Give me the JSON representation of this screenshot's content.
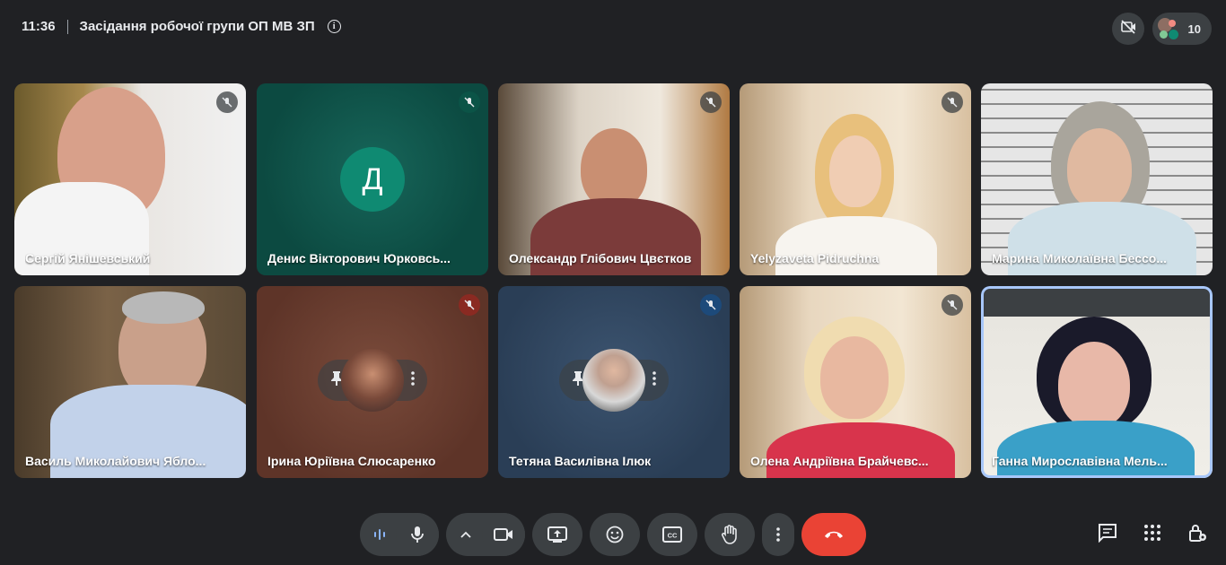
{
  "meeting": {
    "time": "11:36",
    "title": "Засідання робочої групи ОП МВ ЗП",
    "participant_count": "10"
  },
  "participants": [
    {
      "name": "Сергій Янішевський",
      "muted": true
    },
    {
      "name": "Денис Вікторович Юрковсь...",
      "avatar_letter": "Д",
      "muted": true
    },
    {
      "name": "Олександр Глібович Цвєтков",
      "muted": true
    },
    {
      "name": "Yelyzaveta Pidruchna",
      "muted": true
    },
    {
      "name": "Марина Миколаївна Бессо...",
      "muted": false
    },
    {
      "name": "Василь Миколайович Ябло...",
      "muted": false
    },
    {
      "name": "Ірина Юріївна Слюсаренко",
      "muted": true
    },
    {
      "name": "Тетяна Василівна Ілюк",
      "muted": true
    },
    {
      "name": "Олена Андріївна Брайчевс...",
      "muted": true
    },
    {
      "name": "Ганна Мирославівна Мель...",
      "muted": false,
      "speaking": true
    }
  ],
  "colors": {
    "background": "#202124",
    "control": "#3c4043",
    "end_call": "#ea4335",
    "active_border": "#a8c7fa",
    "avatar_teal": "#0f8a72"
  },
  "icons": {
    "info": "info-icon",
    "camera_off_top": "camera-off-icon",
    "audio_levels": "audio-level-icon",
    "microphone": "microphone-icon",
    "chevron": "chevron-up-icon",
    "camera": "camera-icon",
    "present": "present-screen-icon",
    "emoji": "emoji-icon",
    "captions": "captions-icon",
    "raise_hand": "raise-hand-icon",
    "more": "more-vert-icon",
    "end_call": "end-call-icon",
    "chat": "chat-icon",
    "activities": "activities-icon",
    "host_controls": "host-controls-icon"
  }
}
